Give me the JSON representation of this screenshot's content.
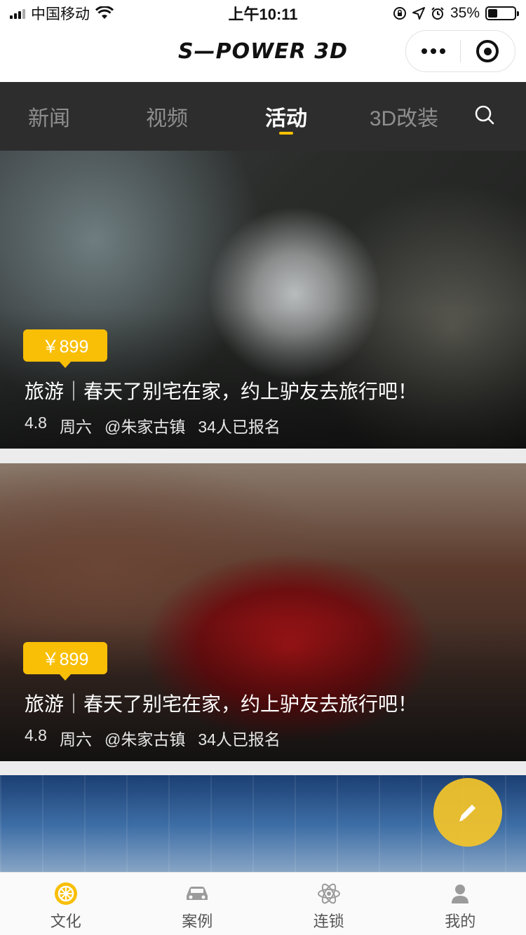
{
  "status_bar": {
    "carrier": "中国移动",
    "time": "上午10:11",
    "battery_text": "35%",
    "battery_level": 0.35
  },
  "header": {
    "logo_text": "S—POWER 3D"
  },
  "tabs": [
    {
      "label": "新闻",
      "active": false
    },
    {
      "label": "视频",
      "active": false
    },
    {
      "label": "活动",
      "active": true
    },
    {
      "label": "3D改装",
      "active": false
    }
  ],
  "cards": [
    {
      "price": "￥899",
      "title": "旅游｜春天了别宅在家，约上驴友去旅行吧！",
      "rating": "4.8",
      "day": "周六",
      "location": "@朱家古镇",
      "signups": "34人已报名"
    },
    {
      "price": "￥899",
      "title": "旅游｜春天了别宅在家，约上驴友去旅行吧！",
      "rating": "4.8",
      "day": "周六",
      "location": "@朱家古镇",
      "signups": "34人已报名"
    }
  ],
  "bottom_nav": [
    {
      "label": "文化",
      "icon": "wheel-icon",
      "active": true
    },
    {
      "label": "案例",
      "icon": "car-icon",
      "active": false
    },
    {
      "label": "连锁",
      "icon": "atom-icon",
      "active": false
    },
    {
      "label": "我的",
      "icon": "user-icon",
      "active": false
    }
  ],
  "colors": {
    "accent": "#f9bf06",
    "tab_bar_bg": "#2d2d2d",
    "inactive_tab_text": "#8f8f8f"
  }
}
